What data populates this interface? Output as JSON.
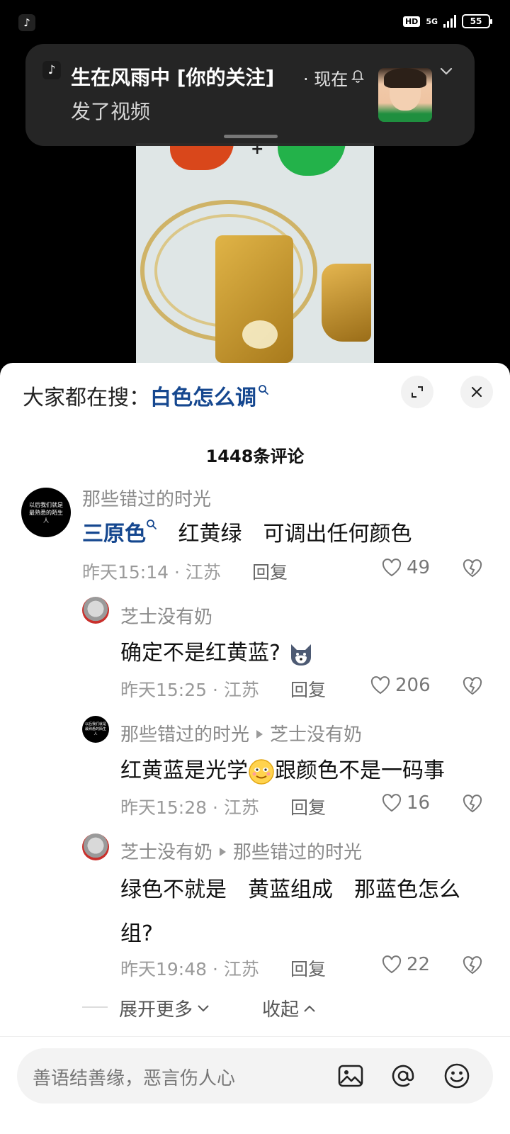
{
  "status_bar": {
    "app_icon": "tiktok-icon",
    "hd": "HD",
    "network": "5G",
    "battery": "55"
  },
  "notification": {
    "app_icon": "tiktok-icon",
    "title": "生在风雨中 [你的关注]",
    "time": "· 现在",
    "body": "发了视频"
  },
  "sheet": {
    "search_prefix": "大家都在搜：",
    "search_term": "白色怎么调",
    "comment_count": "1448条评论"
  },
  "comments": [
    {
      "user": "那些错过的时光",
      "avatar_text": "以后我们就是最熟悉的陌生人",
      "topic": "三原色",
      "text": "红黄绿　可调出任何颜色",
      "time_loc": "昨天15:14 · 江苏",
      "reply": "回复",
      "likes": "49"
    },
    {
      "user": "芝士没有奶",
      "text": "确定不是红黄蓝?",
      "emoji": "dog-emoji",
      "time_loc": "昨天15:25 · 江苏",
      "reply": "回复",
      "likes": "206"
    },
    {
      "user": "那些错过的时光",
      "reply_to": "芝士没有奶",
      "avatar_text": "以后我们就是最熟悉的陌生人",
      "text_a": "红黄蓝是光学",
      "emoji": "smile-emoji",
      "text_b": "跟颜色不是一码事",
      "time_loc": "昨天15:28 · 江苏",
      "reply": "回复",
      "likes": "16"
    },
    {
      "user": "芝士没有奶",
      "reply_to": "那些错过的时光",
      "text_line1": "绿色不就是　黄蓝组成　那蓝色怎么",
      "text_line2": "组?",
      "time_loc": "昨天19:48 · 江苏",
      "reply": "回复",
      "likes": "22"
    }
  ],
  "thread_controls": {
    "expand_more": "展开更多",
    "collapse": "收起"
  },
  "input": {
    "placeholder": "善语结善缘，恶言伤人心"
  },
  "colors": {
    "link": "#15478f",
    "sheet_bg": "#ffffff",
    "notification_bg": "#262626"
  }
}
